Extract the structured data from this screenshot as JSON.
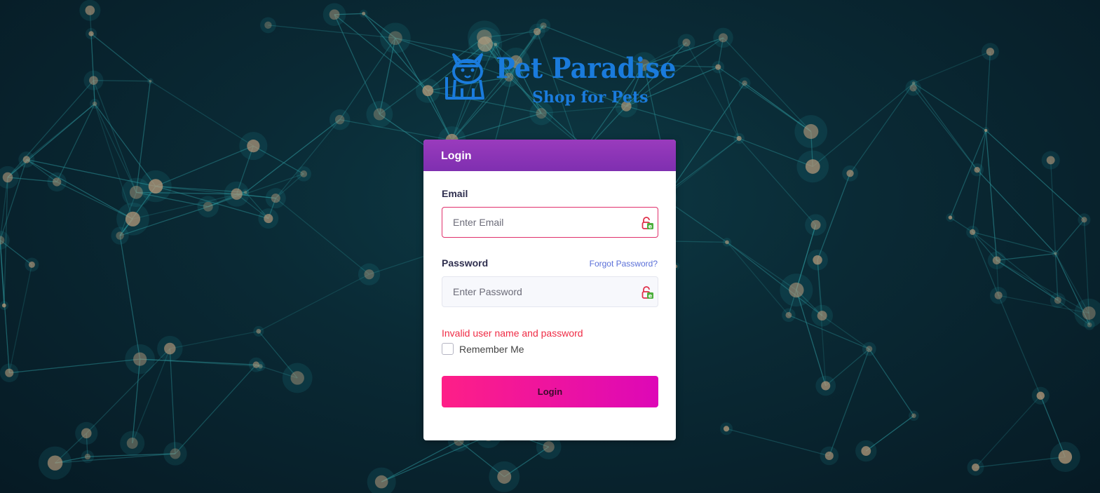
{
  "brand": {
    "title": "Pet Paradise",
    "subtitle": "Shop for Pets",
    "color": "#1a7bdc"
  },
  "card": {
    "header": "Login",
    "email": {
      "label": "Email",
      "placeholder": "Enter Email",
      "value": ""
    },
    "password": {
      "label": "Password",
      "placeholder": "Enter Password",
      "value": ""
    },
    "forgot_link": "Forgot Password?",
    "error": "Invalid user name and password",
    "remember_label": "Remember Me",
    "remember_checked": false,
    "submit_label": "Login"
  },
  "colors": {
    "header_purple": "#8a35b5",
    "button_pink": "#fe1f87",
    "error_red": "#ef2b45",
    "link_blue": "#5a6fd8"
  }
}
